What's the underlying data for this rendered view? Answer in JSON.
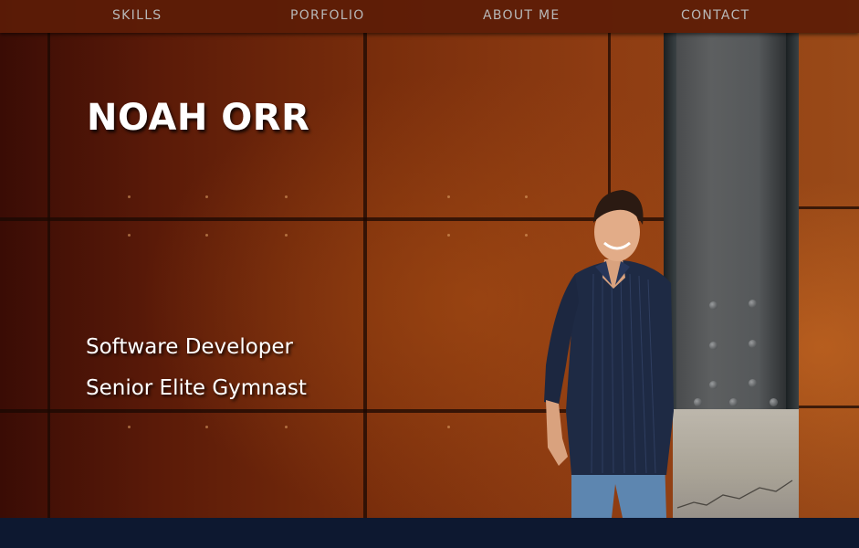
{
  "nav": {
    "items": [
      {
        "label": "SKILLS"
      },
      {
        "label": "PORFOLIO"
      },
      {
        "label": "ABOUT ME"
      },
      {
        "label": "CONTACT"
      }
    ]
  },
  "hero": {
    "name": "NOAH ORR",
    "taglines": [
      "Software Developer",
      "Senior Elite Gymnast"
    ]
  },
  "colors": {
    "nav_bg": "#5c1c06",
    "nav_text": "#b8b8b8",
    "hero_text": "#ffffff",
    "footer_bg": "#0d1830"
  }
}
